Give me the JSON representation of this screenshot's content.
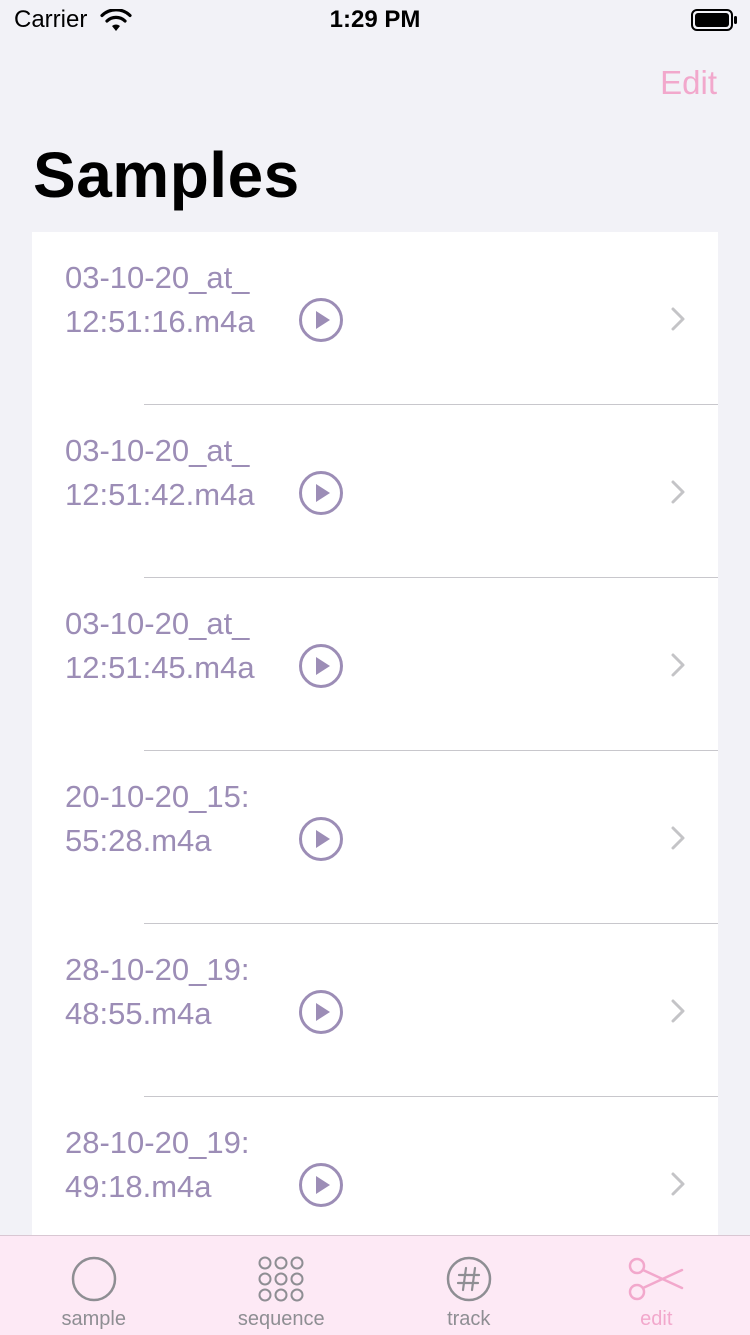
{
  "status_bar": {
    "carrier": "Carrier",
    "time": "1:29 PM"
  },
  "nav": {
    "edit_label": "Edit",
    "title": "Samples"
  },
  "samples": [
    {
      "name": "03-10-20_at_12:51:16.m4a"
    },
    {
      "name": "03-10-20_at_12:51:42.m4a"
    },
    {
      "name": "03-10-20_at_12:51:45.m4a"
    },
    {
      "name": "20-10-20_15:55:28.m4a"
    },
    {
      "name": "28-10-20_19:48:55.m4a"
    },
    {
      "name": "28-10-20_19:49:18.m4a"
    }
  ],
  "tabs": [
    {
      "label": "sample",
      "icon": "circle-icon"
    },
    {
      "label": "sequence",
      "icon": "grid-dots-icon"
    },
    {
      "label": "track",
      "icon": "hash-circle-icon"
    },
    {
      "label": "edit",
      "icon": "scissors-icon"
    }
  ],
  "colors": {
    "accent": "#f2a8cc",
    "item_text": "#9c8db6",
    "tab_bar_bg": "#fde9f5",
    "background": "#f2f2f7"
  }
}
